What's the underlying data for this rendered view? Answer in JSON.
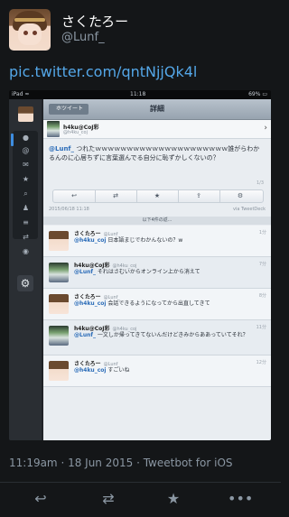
{
  "tweet": {
    "author_name": "さくたろー",
    "author_handle": "@Lunf_",
    "link": "pic.twitter.com/qntNjjQk4l",
    "meta": "11:19am · 18 Jun 2015 · Tweetbot for iOS",
    "actions": {
      "reply": "reply-icon",
      "retweet": "retweet-icon",
      "favorite": "favorite-icon",
      "more": "more-icon"
    }
  },
  "screenshot": {
    "status": {
      "carrier": "iPad ≈",
      "time": "11:18",
      "battery": "69% ▭"
    },
    "nav": {
      "back_label": "ホツイート",
      "title": "詳細"
    },
    "detail": {
      "name": "h4ku@CoJ彩",
      "handle": "@h4ku_coj",
      "mention": "@Lunf_",
      "text": " つれたｗｗｗｗｗｗｗｗｗｗｗｗｗｗｗｗｗｗｗｗｗ誰がらわかるんのに心居ちずに言葉選んでる自分に恥ずかしくないの？",
      "page": "1/3",
      "time": "2015/06/18 11:18",
      "via": "via TweetDeck",
      "actions": [
        "reply-icon",
        "retweet-icon",
        "favorite-icon",
        "share-icon",
        "gear-icon"
      ]
    },
    "more_label": "以下4件の返...",
    "rows": [
      {
        "name": "さくたろー",
        "handle": "@Lunf_",
        "time": "1分",
        "mention": "@h4ku_coj",
        "text": " 日本語まじでわかんないの？w",
        "avatar": "girl"
      },
      {
        "name": "h4ku@CoJ彩",
        "handle": "@h4ku_coj",
        "time": "7分",
        "mention": "@Lunf_",
        "text": " それはさむいからオンライン上から消えて",
        "avatar": "gun"
      },
      {
        "name": "さくたろー",
        "handle": "@Lunf_",
        "time": "8分",
        "mention": "@h4ku_coj",
        "text": " 会話できるようになってから出直してきて",
        "avatar": "girl"
      },
      {
        "name": "h4ku@CoJ彩",
        "handle": "@h4ku_coj",
        "time": "11分",
        "mention": "@Lunf_",
        "text": " 一文しか帰ってきてないんだけどきみからああっていてそれ？",
        "avatar": "gun"
      },
      {
        "name": "さくたろー",
        "handle": "@Lunf_",
        "time": "12分",
        "mention": "@h4ku_coj",
        "text": " すごいね",
        "avatar": "girl"
      }
    ]
  }
}
